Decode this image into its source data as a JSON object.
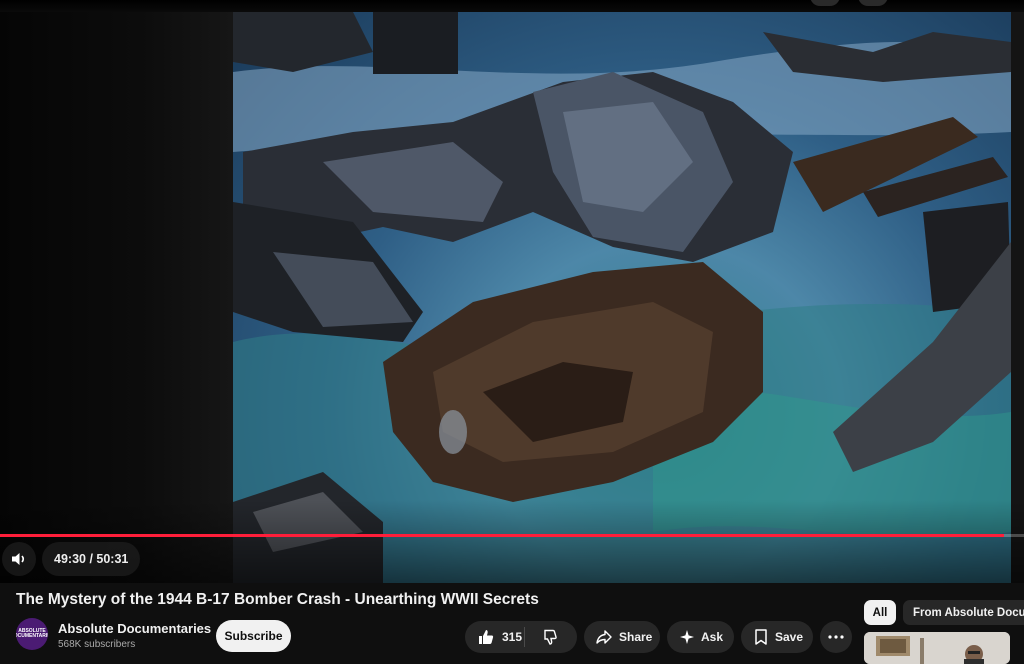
{
  "player": {
    "current_time": "49:30",
    "separator": " / ",
    "duration": "50:31",
    "progress_fraction": 0.98,
    "progress_color": "#ff1e3a"
  },
  "video": {
    "title": "The Mystery of the 1944 B-17 Bomber Crash - Unearthing WWII Secrets"
  },
  "channel": {
    "name": "Absolute Documentaries",
    "subscribers": "568K subscribers",
    "avatar_text": "ABSOLUTE DOCUMENTARIES",
    "subscribe_label": "Subscribe"
  },
  "actions": {
    "like_count": "315",
    "share_label": "Share",
    "ask_label": "Ask",
    "save_label": "Save"
  },
  "sidebar": {
    "chips": [
      "All",
      "From Absolute Docume"
    ]
  },
  "icons": [
    "volume-icon",
    "like-icon",
    "dislike-icon",
    "share-icon",
    "ask-sparkle-icon",
    "save-icon",
    "more-icon"
  ]
}
